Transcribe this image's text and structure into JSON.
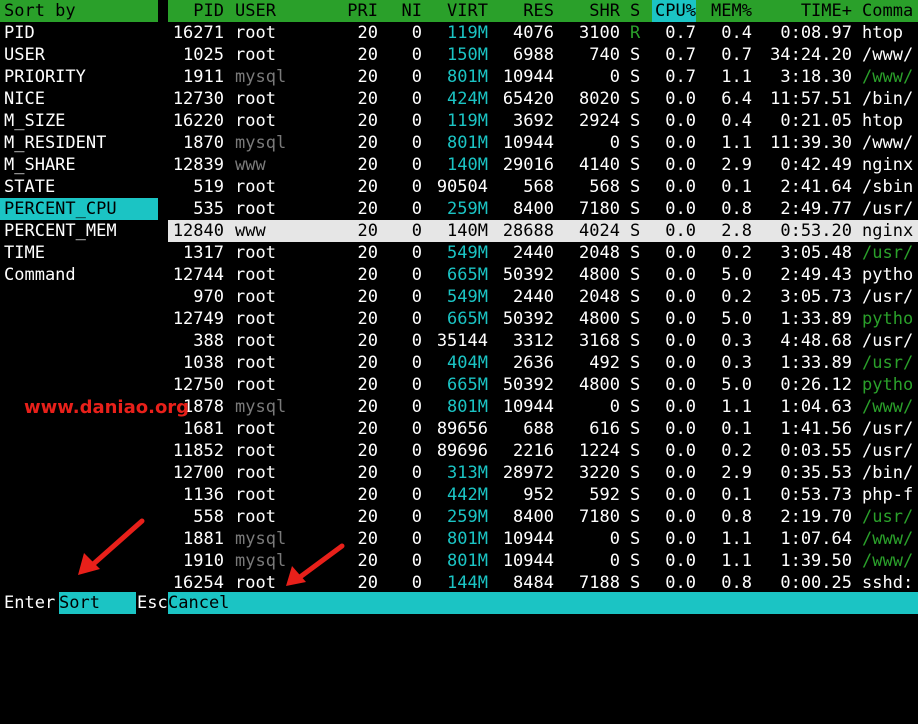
{
  "sort_panel": {
    "title": "Sort by",
    "items": [
      "PID",
      "USER",
      "PRIORITY",
      "NICE",
      "M_SIZE",
      "M_RESIDENT",
      "M_SHARE",
      "STATE",
      "PERCENT_CPU",
      "PERCENT_MEM",
      "TIME",
      "Command"
    ],
    "selected": "PERCENT_CPU"
  },
  "process_table": {
    "headers": {
      "pid": "PID",
      "user": "USER",
      "pri": "PRI",
      "ni": "NI",
      "virt": "VIRT",
      "res": "RES",
      "shr": "SHR",
      "s": "S",
      "cpu": "CPU%",
      "mem": "MEM%",
      "time": "TIME+",
      "cmd": "Comma"
    },
    "active_header": "CPU%",
    "highlighted_pid": "12840",
    "rows": [
      {
        "pid": "16271",
        "user": "root",
        "pri": "20",
        "ni": "0",
        "virt": "119M",
        "res": "4076",
        "shr": "3100",
        "s": "R",
        "cpu": "0.7",
        "mem": "0.4",
        "time": "0:08.97",
        "cmd": "htop"
      },
      {
        "pid": "1025",
        "user": "root",
        "pri": "20",
        "ni": "0",
        "virt": "150M",
        "res": "6988",
        "shr": "740",
        "s": "S",
        "cpu": "0.7",
        "mem": "0.7",
        "time": "34:24.20",
        "cmd": "/www/"
      },
      {
        "pid": "1911",
        "user": "mysql",
        "pri": "20",
        "ni": "0",
        "virt": "801M",
        "res": "10944",
        "shr": "0",
        "s": "S",
        "cpu": "0.7",
        "mem": "1.1",
        "time": "3:18.30",
        "cmd": "/www/"
      },
      {
        "pid": "12730",
        "user": "root",
        "pri": "20",
        "ni": "0",
        "virt": "424M",
        "res": "65420",
        "shr": "8020",
        "s": "S",
        "cpu": "0.0",
        "mem": "6.4",
        "time": "11:57.51",
        "cmd": "/bin/"
      },
      {
        "pid": "16220",
        "user": "root",
        "pri": "20",
        "ni": "0",
        "virt": "119M",
        "res": "3692",
        "shr": "2924",
        "s": "S",
        "cpu": "0.0",
        "mem": "0.4",
        "time": "0:21.05",
        "cmd": "htop"
      },
      {
        "pid": "1870",
        "user": "mysql",
        "pri": "20",
        "ni": "0",
        "virt": "801M",
        "res": "10944",
        "shr": "0",
        "s": "S",
        "cpu": "0.0",
        "mem": "1.1",
        "time": "11:39.30",
        "cmd": "/www/"
      },
      {
        "pid": "12839",
        "user": "www",
        "pri": "20",
        "ni": "0",
        "virt": "140M",
        "res": "29016",
        "shr": "4140",
        "s": "S",
        "cpu": "0.0",
        "mem": "2.9",
        "time": "0:42.49",
        "cmd": "nginx"
      },
      {
        "pid": "519",
        "user": "root",
        "pri": "20",
        "ni": "0",
        "virt": "90504",
        "res": "568",
        "shr": "568",
        "s": "S",
        "cpu": "0.0",
        "mem": "0.1",
        "time": "2:41.64",
        "cmd": "/sbin"
      },
      {
        "pid": "535",
        "user": "root",
        "pri": "20",
        "ni": "0",
        "virt": "259M",
        "res": "8400",
        "shr": "7180",
        "s": "S",
        "cpu": "0.0",
        "mem": "0.8",
        "time": "2:49.77",
        "cmd": "/usr/"
      },
      {
        "pid": "12840",
        "user": "www",
        "pri": "20",
        "ni": "0",
        "virt": "140M",
        "res": "28688",
        "shr": "4024",
        "s": "S",
        "cpu": "0.0",
        "mem": "2.8",
        "time": "0:53.20",
        "cmd": "nginx"
      },
      {
        "pid": "1317",
        "user": "root",
        "pri": "20",
        "ni": "0",
        "virt": "549M",
        "res": "2440",
        "shr": "2048",
        "s": "S",
        "cpu": "0.0",
        "mem": "0.2",
        "time": "3:05.48",
        "cmd": "/usr/"
      },
      {
        "pid": "12744",
        "user": "root",
        "pri": "20",
        "ni": "0",
        "virt": "665M",
        "res": "50392",
        "shr": "4800",
        "s": "S",
        "cpu": "0.0",
        "mem": "5.0",
        "time": "2:49.43",
        "cmd": "pytho"
      },
      {
        "pid": "970",
        "user": "root",
        "pri": "20",
        "ni": "0",
        "virt": "549M",
        "res": "2440",
        "shr": "2048",
        "s": "S",
        "cpu": "0.0",
        "mem": "0.2",
        "time": "3:05.73",
        "cmd": "/usr/"
      },
      {
        "pid": "12749",
        "user": "root",
        "pri": "20",
        "ni": "0",
        "virt": "665M",
        "res": "50392",
        "shr": "4800",
        "s": "S",
        "cpu": "0.0",
        "mem": "5.0",
        "time": "1:33.89",
        "cmd": "pytho"
      },
      {
        "pid": "388",
        "user": "root",
        "pri": "20",
        "ni": "0",
        "virt": "35144",
        "res": "3312",
        "shr": "3168",
        "s": "S",
        "cpu": "0.0",
        "mem": "0.3",
        "time": "4:48.68",
        "cmd": "/usr/"
      },
      {
        "pid": "1038",
        "user": "root",
        "pri": "20",
        "ni": "0",
        "virt": "404M",
        "res": "2636",
        "shr": "492",
        "s": "S",
        "cpu": "0.0",
        "mem": "0.3",
        "time": "1:33.89",
        "cmd": "/usr/"
      },
      {
        "pid": "12750",
        "user": "root",
        "pri": "20",
        "ni": "0",
        "virt": "665M",
        "res": "50392",
        "shr": "4800",
        "s": "S",
        "cpu": "0.0",
        "mem": "5.0",
        "time": "0:26.12",
        "cmd": "pytho"
      },
      {
        "pid": "1878",
        "user": "mysql",
        "pri": "20",
        "ni": "0",
        "virt": "801M",
        "res": "10944",
        "shr": "0",
        "s": "S",
        "cpu": "0.0",
        "mem": "1.1",
        "time": "1:04.63",
        "cmd": "/www/"
      },
      {
        "pid": "1681",
        "user": "root",
        "pri": "20",
        "ni": "0",
        "virt": "89656",
        "res": "688",
        "shr": "616",
        "s": "S",
        "cpu": "0.0",
        "mem": "0.1",
        "time": "1:41.56",
        "cmd": "/usr/"
      },
      {
        "pid": "11852",
        "user": "root",
        "pri": "20",
        "ni": "0",
        "virt": "89696",
        "res": "2216",
        "shr": "1224",
        "s": "S",
        "cpu": "0.0",
        "mem": "0.2",
        "time": "0:03.55",
        "cmd": "/usr/"
      },
      {
        "pid": "12700",
        "user": "root",
        "pri": "20",
        "ni": "0",
        "virt": "313M",
        "res": "28972",
        "shr": "3220",
        "s": "S",
        "cpu": "0.0",
        "mem": "2.9",
        "time": "0:35.53",
        "cmd": "/bin/"
      },
      {
        "pid": "1136",
        "user": "root",
        "pri": "20",
        "ni": "0",
        "virt": "442M",
        "res": "952",
        "shr": "592",
        "s": "S",
        "cpu": "0.0",
        "mem": "0.1",
        "time": "0:53.73",
        "cmd": "php-f"
      },
      {
        "pid": "558",
        "user": "root",
        "pri": "20",
        "ni": "0",
        "virt": "259M",
        "res": "8400",
        "shr": "7180",
        "s": "S",
        "cpu": "0.0",
        "mem": "0.8",
        "time": "2:19.70",
        "cmd": "/usr/"
      },
      {
        "pid": "1881",
        "user": "mysql",
        "pri": "20",
        "ni": "0",
        "virt": "801M",
        "res": "10944",
        "shr": "0",
        "s": "S",
        "cpu": "0.0",
        "mem": "1.1",
        "time": "1:07.64",
        "cmd": "/www/"
      },
      {
        "pid": "1910",
        "user": "mysql",
        "pri": "20",
        "ni": "0",
        "virt": "801M",
        "res": "10944",
        "shr": "0",
        "s": "S",
        "cpu": "0.0",
        "mem": "1.1",
        "time": "1:39.50",
        "cmd": "/www/"
      },
      {
        "pid": "16254",
        "user": "root",
        "pri": "20",
        "ni": "0",
        "virt": "144M",
        "res": "8484",
        "shr": "7188",
        "s": "S",
        "cpu": "0.0",
        "mem": "0.8",
        "time": "0:00.25",
        "cmd": "sshd:"
      }
    ]
  },
  "footer": {
    "enter_key": "Enter",
    "enter_label": "Sort",
    "esc_key": "Esc",
    "esc_label": "Cancel"
  },
  "watermark": "www.daniao.org",
  "colors": {
    "green": "#2aa02a",
    "cyan": "#1bc4c4",
    "highlight": "#e6e6e6",
    "gray_user": "#7a7a7a",
    "red": "#e8201a"
  }
}
